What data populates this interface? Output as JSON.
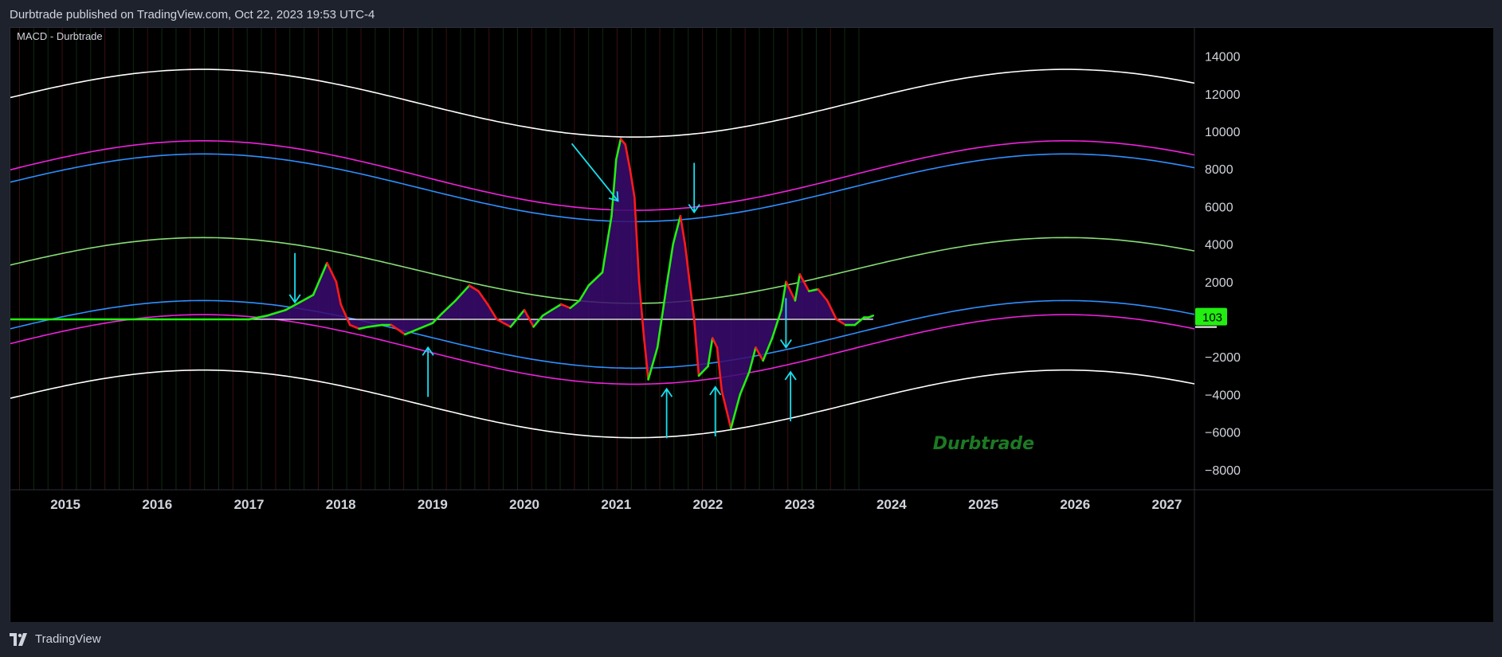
{
  "header": {
    "published": "Durbtrade published on TradingView.com, Oct 22, 2023 19:53 UTC-4"
  },
  "footer": {
    "brand": "TradingView"
  },
  "colors": {
    "background": "#000000",
    "frame": "#1e222d",
    "macd_up": "#22ee11",
    "macd_down": "#ff1a1a",
    "fill": "#3a0a6e",
    "fill_neg": "#0a0a70",
    "band_outer": "#ffffff",
    "band_magenta": "#ee22dd",
    "band_blue": "#2f8fff",
    "band_green": "#88dd77",
    "arrow": "#18e0f0",
    "watermark": "#1c7a23",
    "last_value_bg": "#22ee11"
  },
  "chart_data": {
    "type": "line",
    "title": "MACD - Durbtrade",
    "watermark": "Durbtrade",
    "last_value": "103",
    "x_ticks": [
      "2015",
      "2016",
      "2017",
      "2018",
      "2019",
      "2020",
      "2021",
      "2022",
      "2023",
      "2024",
      "2025",
      "2026",
      "2027"
    ],
    "y_ticks": [
      "14000",
      "12000",
      "10000",
      "8000",
      "6000",
      "4000",
      "2000",
      "−2000",
      "−4000",
      "−6000",
      "−8000"
    ],
    "y_tick_values": [
      14000,
      12000,
      10000,
      8000,
      6000,
      4000,
      2000,
      -2000,
      -4000,
      -6000,
      -8000
    ],
    "xlim": [
      2014.4,
      2027.3
    ],
    "ylim": [
      -9000,
      15500
    ],
    "zero_line": 0,
    "bands": {
      "center_period_peak_x": 2016.5,
      "center_period_trough_x": 2021.2,
      "outer_upper": [
        11700,
        13300,
        9700,
        13300,
        12500
      ],
      "series": [
        {
          "name": "outer",
          "color": "band_outer",
          "upper_mid": 11500,
          "lower_mid": -4500,
          "amp": 1800
        },
        {
          "name": "magenta",
          "color": "band_magenta",
          "upper_mid": 7650,
          "lower_mid": -1600,
          "amp": 1850
        },
        {
          "name": "blue",
          "color": "band_blue",
          "upper_mid": 7000,
          "lower_mid": -800,
          "amp": 1800
        },
        {
          "name": "green",
          "color": "band_green",
          "upper_mid": 2600,
          "lower_mid": null,
          "amp": 1750
        }
      ]
    },
    "macd": {
      "x": [
        2014.4,
        2015.0,
        2015.5,
        2016.0,
        2016.5,
        2017.0,
        2017.2,
        2017.4,
        2017.55,
        2017.7,
        2017.85,
        2017.95,
        2018.0,
        2018.1,
        2018.2,
        2018.3,
        2018.45,
        2018.55,
        2018.7,
        2018.85,
        2019.0,
        2019.1,
        2019.25,
        2019.4,
        2019.5,
        2019.6,
        2019.7,
        2019.85,
        2019.95,
        2020.0,
        2020.1,
        2020.2,
        2020.3,
        2020.4,
        2020.5,
        2020.6,
        2020.7,
        2020.85,
        2020.95,
        2021.0,
        2021.05,
        2021.1,
        2021.15,
        2021.2,
        2021.25,
        2021.3,
        2021.35,
        2021.45,
        2021.55,
        2021.62,
        2021.7,
        2021.75,
        2021.8,
        2021.85,
        2021.9,
        2022.0,
        2022.05,
        2022.1,
        2022.15,
        2022.25,
        2022.35,
        2022.45,
        2022.52,
        2022.6,
        2022.7,
        2022.8,
        2022.85,
        2022.95,
        2023.0,
        2023.1,
        2023.2,
        2023.3,
        2023.4,
        2023.5,
        2023.6,
        2023.7,
        2023.75,
        2023.8
      ],
      "y": [
        0,
        0,
        0,
        0,
        0,
        0,
        200,
        500,
        900,
        1300,
        3000,
        2000,
        800,
        -300,
        -500,
        -400,
        -300,
        -300,
        -800,
        -500,
        -200,
        300,
        1000,
        1800,
        1500,
        800,
        0,
        -400,
        200,
        500,
        -400,
        200,
        500,
        800,
        600,
        1000,
        1800,
        2500,
        5500,
        8500,
        9600,
        9300,
        8000,
        6500,
        2000,
        -800,
        -3200,
        -1500,
        1800,
        4000,
        5500,
        4000,
        2000,
        0,
        -3000,
        -2500,
        -1000,
        -1500,
        -3800,
        -5800,
        -4000,
        -2800,
        -1500,
        -2200,
        -1000,
        500,
        2000,
        1000,
        2400,
        1500,
        1600,
        1000,
        0,
        -300,
        -300,
        100,
        103,
        200
      ]
    },
    "arrows": [
      {
        "x": 2017.5,
        "dir": "down",
        "tip": 900
      },
      {
        "x": 2018.95,
        "dir": "up",
        "tip": -1500
      },
      {
        "x": 2021.02,
        "dir": "down",
        "tip": 6300,
        "diag": true
      },
      {
        "x": 2021.85,
        "dir": "down",
        "tip": 5700
      },
      {
        "x": 2021.55,
        "dir": "up",
        "tip": -3700
      },
      {
        "x": 2022.08,
        "dir": "up",
        "tip": -3600
      },
      {
        "x": 2022.85,
        "dir": "down",
        "tip": -1500
      },
      {
        "x": 2022.9,
        "dir": "up",
        "tip": -2800
      }
    ]
  }
}
